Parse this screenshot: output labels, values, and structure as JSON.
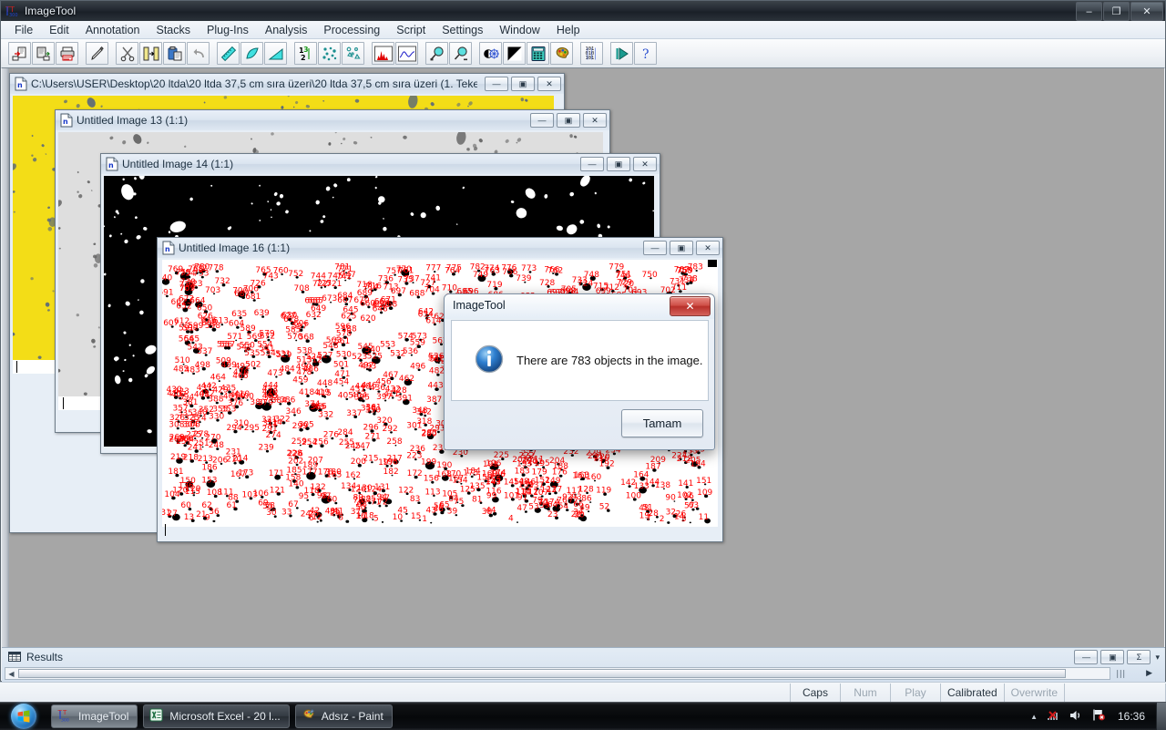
{
  "app": {
    "title": "ImageTool",
    "window_controls": {
      "minimize": "–",
      "restore": "❐",
      "close": "✕"
    }
  },
  "menubar": {
    "items": [
      {
        "label": "File"
      },
      {
        "label": "Edit"
      },
      {
        "label": "Annotation"
      },
      {
        "label": "Stacks"
      },
      {
        "label": "Plug-Ins"
      },
      {
        "label": "Analysis"
      },
      {
        "label": "Processing"
      },
      {
        "label": "Script"
      },
      {
        "label": "Settings"
      },
      {
        "label": "Window"
      },
      {
        "label": "Help"
      }
    ]
  },
  "toolbar": {
    "buttons": [
      {
        "name": "open-image-icon",
        "title": "Open"
      },
      {
        "name": "save-image-icon",
        "title": "Save"
      },
      {
        "name": "print-icon",
        "title": "Print"
      },
      {
        "name": "pencil-icon",
        "title": "Draw"
      },
      {
        "name": "scissors-cut-icon",
        "title": "Cut"
      },
      {
        "name": "copy-region-icon",
        "title": "Copy"
      },
      {
        "name": "paste-icon",
        "title": "Paste"
      },
      {
        "name": "undo-icon",
        "title": "Undo"
      },
      {
        "name": "ruler-measure-icon",
        "title": "Measure length"
      },
      {
        "name": "area-measure-icon",
        "title": "Measure area"
      },
      {
        "name": "angle-measure-icon",
        "title": "Measure angle"
      },
      {
        "name": "count-objects-icon",
        "title": "Count objects"
      },
      {
        "name": "object-analysis-icon",
        "title": "Object analysis"
      },
      {
        "name": "particle-analysis-icon",
        "title": "Particle analysis"
      },
      {
        "name": "histogram-icon",
        "title": "Histogram"
      },
      {
        "name": "line-profile-icon",
        "title": "Line profile"
      },
      {
        "name": "zoom-in-icon",
        "title": "Zoom in"
      },
      {
        "name": "zoom-out-icon",
        "title": "Zoom out"
      },
      {
        "name": "contrast-icon",
        "title": "Brightness / contrast"
      },
      {
        "name": "threshold-icon",
        "title": "Threshold"
      },
      {
        "name": "calculator-icon",
        "title": "Image calculator"
      },
      {
        "name": "palette-icon",
        "title": "Color palette"
      },
      {
        "name": "binary-ops-icon",
        "title": "Binary operations"
      },
      {
        "name": "run-macro-icon",
        "title": "Run"
      },
      {
        "name": "help-icon",
        "title": "Help"
      }
    ]
  },
  "windows": [
    {
      "id": "win-source",
      "title": "C:\\Users\\USER\\Desktop\\20 ltda\\20 ltda 37,5 cm sıra üzeri\\20 ltda 37,5 cm sıra üzeri (1. Teke...",
      "image_kind": "yellow-speckled-photo"
    },
    {
      "id": "win-13",
      "title": "Untitled Image 13 (1:1)",
      "image_kind": "grayscale-speckled"
    },
    {
      "id": "win-14",
      "title": "Untitled Image 14 (1:1)",
      "image_kind": "binary-black-white"
    },
    {
      "id": "win-16",
      "title": "Untitled Image 16 (1:1)",
      "image_kind": "counted-objects-numbered-red"
    }
  ],
  "child_window_controls": {
    "minimize": "—",
    "restore": "▣",
    "close": "✕"
  },
  "dialog": {
    "title": "ImageTool",
    "message": "There are 783 objects in the image.",
    "ok_label": "Tamam",
    "close_label": "✕",
    "icon": "info-icon",
    "object_count": 783
  },
  "results": {
    "label": "Results",
    "icon": "table-icon",
    "controls": {
      "minimize": "—",
      "restore": "▣",
      "close": "Σ",
      "dropdown": "▾"
    },
    "scroll_left": "◀",
    "scroll_right": "▶",
    "grip": "∣∣∣"
  },
  "statusbar": {
    "cells": [
      {
        "label": "Caps",
        "active": true
      },
      {
        "label": "Num",
        "active": false
      },
      {
        "label": "Play",
        "active": false
      },
      {
        "label": "Calibrated",
        "active": true
      },
      {
        "label": "Overwrite",
        "active": false
      }
    ]
  },
  "taskbar": {
    "start_label": "Start",
    "tasks": [
      {
        "label": "ImageTool",
        "icon": "imagetool-icon",
        "active": true
      },
      {
        "label": "Microsoft Excel - 20 l...",
        "icon": "excel-icon",
        "active": false
      },
      {
        "label": "Adsız - Paint",
        "icon": "paint-icon",
        "active": false
      }
    ],
    "tray": {
      "show_hidden": "▲",
      "icons": [
        "network-disconnected-icon",
        "volume-icon",
        "flag-action-center-icon"
      ],
      "clock": "16:36"
    }
  },
  "colors": {
    "accent_red": "#ff0000",
    "dialog_close_red": "#c6433c",
    "mdi_background": "#a6a6a6",
    "yellow_sample": "#f3dd17",
    "gray_sample": "#dedede"
  }
}
